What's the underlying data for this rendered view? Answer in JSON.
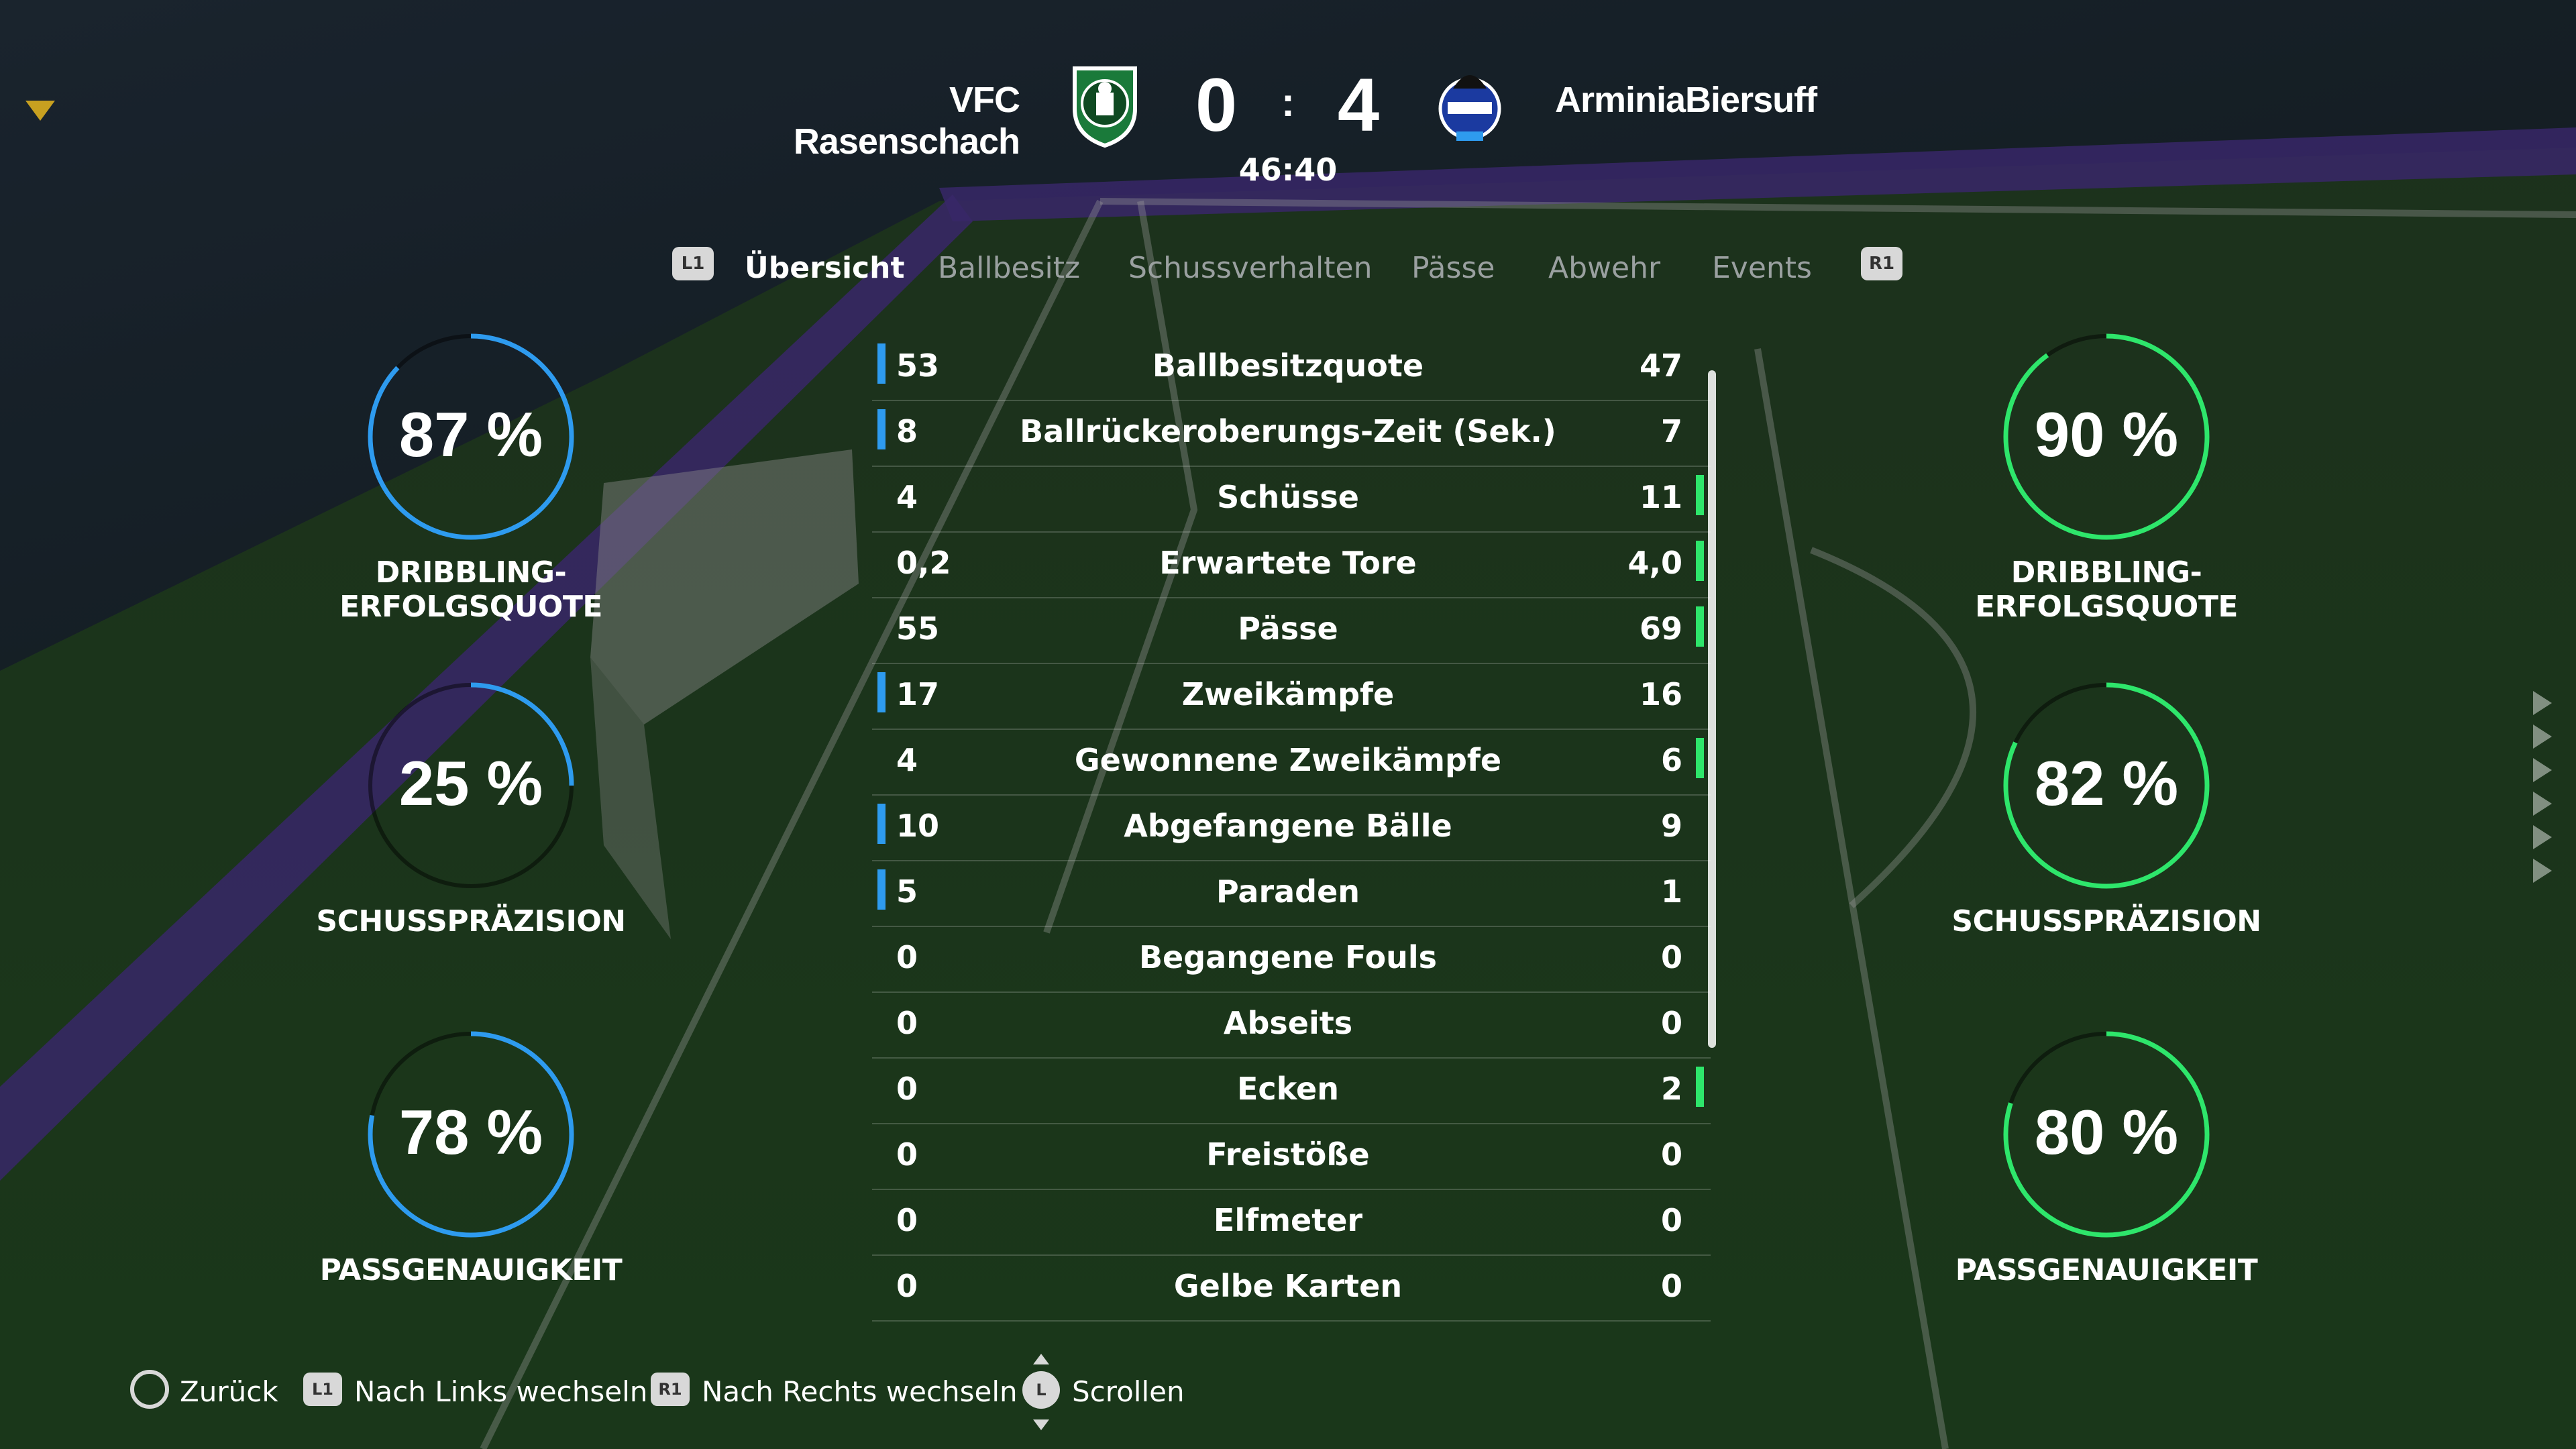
{
  "match": {
    "home_team": "VFC Rasenschach",
    "away_team": "ArminiaBiersuff",
    "home_score": "0",
    "separator": ":",
    "away_score": "4",
    "clock": "46:40",
    "home_color": "#2e9bef",
    "away_color": "#2ee66b"
  },
  "tabs": {
    "left_button": "L1",
    "right_button": "R1",
    "items": [
      {
        "label": "Übersicht",
        "active": true
      },
      {
        "label": "Ballbesitz",
        "active": false
      },
      {
        "label": "Schussverhalten",
        "active": false
      },
      {
        "label": "Pässe",
        "active": false
      },
      {
        "label": "Abwehr",
        "active": false
      },
      {
        "label": "Events",
        "active": false
      }
    ]
  },
  "gauges": {
    "home": [
      {
        "value": "87 %",
        "fraction": 0.87,
        "label": "DRIBBLING-ERFOLGSQUOTE"
      },
      {
        "value": "25 %",
        "fraction": 0.25,
        "label": "SCHUSSPRÄZISION"
      },
      {
        "value": "78 %",
        "fraction": 0.78,
        "label": "PASSGENAUIGKEIT"
      }
    ],
    "away": [
      {
        "value": "90 %",
        "fraction": 0.9,
        "label": "DRIBBLING-ERFOLGSQUOTE"
      },
      {
        "value": "82 %",
        "fraction": 0.82,
        "label": "SCHUSSPRÄZISION"
      },
      {
        "value": "80 %",
        "fraction": 0.8,
        "label": "PASSGENAUIGKEIT"
      }
    ]
  },
  "stats": [
    {
      "name": "Ballbesitzquote",
      "home": "53",
      "away": "47",
      "leader": "home"
    },
    {
      "name": "Ballrückeroberungs-Zeit (Sek.)",
      "home": "8",
      "away": "7",
      "leader": "home"
    },
    {
      "name": "Schüsse",
      "home": "4",
      "away": "11",
      "leader": "away"
    },
    {
      "name": "Erwartete Tore",
      "home": "0,2",
      "away": "4,0",
      "leader": "away"
    },
    {
      "name": "Pässe",
      "home": "55",
      "away": "69",
      "leader": "away"
    },
    {
      "name": "Zweikämpfe",
      "home": "17",
      "away": "16",
      "leader": "home"
    },
    {
      "name": "Gewonnene Zweikämpfe",
      "home": "4",
      "away": "6",
      "leader": "away"
    },
    {
      "name": "Abgefangene Bälle",
      "home": "10",
      "away": "9",
      "leader": "home"
    },
    {
      "name": "Paraden",
      "home": "5",
      "away": "1",
      "leader": "home"
    },
    {
      "name": "Begangene Fouls",
      "home": "0",
      "away": "0",
      "leader": "none"
    },
    {
      "name": "Abseits",
      "home": "0",
      "away": "0",
      "leader": "none"
    },
    {
      "name": "Ecken",
      "home": "0",
      "away": "2",
      "leader": "away"
    },
    {
      "name": "Freistöße",
      "home": "0",
      "away": "0",
      "leader": "none"
    },
    {
      "name": "Elfmeter",
      "home": "0",
      "away": "0",
      "leader": "none"
    },
    {
      "name": "Gelbe Karten",
      "home": "0",
      "away": "0",
      "leader": "none"
    }
  ],
  "footer": {
    "back_label": "Zurück",
    "left_button": "L1",
    "left_label": "Nach Links wechseln",
    "right_button": "R1",
    "right_label": "Nach Rechts wechseln",
    "stick_button": "L",
    "scroll_label": "Scrollen"
  },
  "icons": {
    "back": "circle-button-icon",
    "scroll": "left-stick-icon",
    "home_crest": "rasenschach-crest-icon",
    "away_crest": "arminia-crest-icon"
  }
}
